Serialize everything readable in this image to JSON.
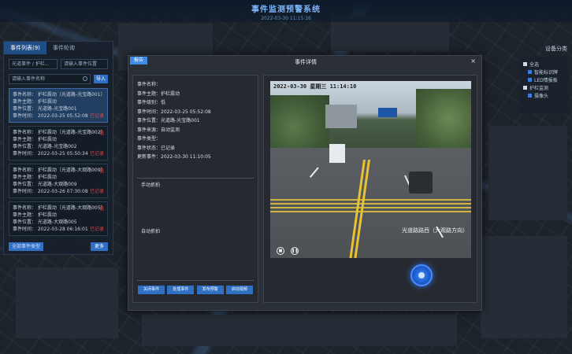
{
  "header": {
    "title": "事件监测预警系统",
    "time": "2022-03-30 11:15:16"
  },
  "left_panel": {
    "tabs": [
      {
        "label": "事件列表(9)",
        "active": true
      },
      {
        "label": "事件轮询",
        "active": false
      }
    ],
    "filter_select": "光道事件 / 护栏...",
    "filter_input_placeholder": "请输入事件位置",
    "search_placeholder": "请输入事件名称",
    "import_label": "导入",
    "events": [
      {
        "name": "事件名称：  护栏震动（光道路-光宝路001）",
        "subject": "事件主题：  护栏震动",
        "position": "事件位置：  光道路-光宝路001",
        "time": "事件时间：  2022-03-25 05:52:08",
        "status": "已记录",
        "flag": "",
        "selected": true
      },
      {
        "name": "事件名称：  护栏震动（光道路-光宝路002）",
        "subject": "事件主题：  护栏震动",
        "position": "事件位置：  光道路-光宝路002",
        "time": "事件时间：  2022-03-25 05:50:34",
        "status": "已记录",
        "flag": "低",
        "selected": false
      },
      {
        "name": "事件名称：  护栏震动（光道路-大观路009）",
        "subject": "事件主题：  护栏震动",
        "position": "事件位置：  光道路-大观路009",
        "time": "事件时间：  2022-03-26 07:30:08",
        "status": "已记录",
        "flag": "低",
        "selected": false
      },
      {
        "name": "事件名称：  护栏震动（光道路-大观路005）",
        "subject": "事件主题：  护栏震动",
        "position": "事件位置：  光道路-大观路005",
        "time": "事件时间：  2022-03-28 06:16:01",
        "status": "已记录",
        "flag": "低",
        "selected": false
      }
    ],
    "more_label": "全部事件类型",
    "back_label": "更多"
  },
  "legend": {
    "title": "设备分类",
    "items": [
      {
        "label": "全选",
        "sub": false
      },
      {
        "label": "智能标识牌",
        "sub": true
      },
      {
        "label": "LED情报板",
        "sub": true
      },
      {
        "label": "护栏监测",
        "sub": false
      },
      {
        "label": "摄像头",
        "sub": true
      }
    ]
  },
  "modal": {
    "badge": "报告",
    "title": "事件详情",
    "close": "×",
    "fields": [
      {
        "k": "事件名称：",
        "v": ""
      },
      {
        "k": "事件主题：",
        "v": "护栏震动"
      },
      {
        "k": "事件级别：",
        "v": "低"
      },
      {
        "k": "事件时间：",
        "v": "2022-03-25 05:52:08"
      },
      {
        "k": "事件位置：",
        "v": "光道路-光宝路001"
      },
      {
        "k": "事件来源：",
        "v": "自动监测"
      },
      {
        "k": "事件类型：",
        "v": ""
      },
      {
        "k": "事件状态：",
        "v": "已记录"
      },
      {
        "k": "更新事件：",
        "v": "2022-03-30 11:10:05"
      }
    ],
    "manual_shot_label": "手动抓拍",
    "auto_shot_label": "自动抓拍",
    "actions": [
      "关闭事件",
      "处理事件",
      "发布预警",
      "启动视频"
    ],
    "video": {
      "timestamp": "2022-03-30 星期三 11:14:10",
      "location": "光道路路西（大观路方向）",
      "top_bar": "1 载入 视频 工具"
    }
  }
}
